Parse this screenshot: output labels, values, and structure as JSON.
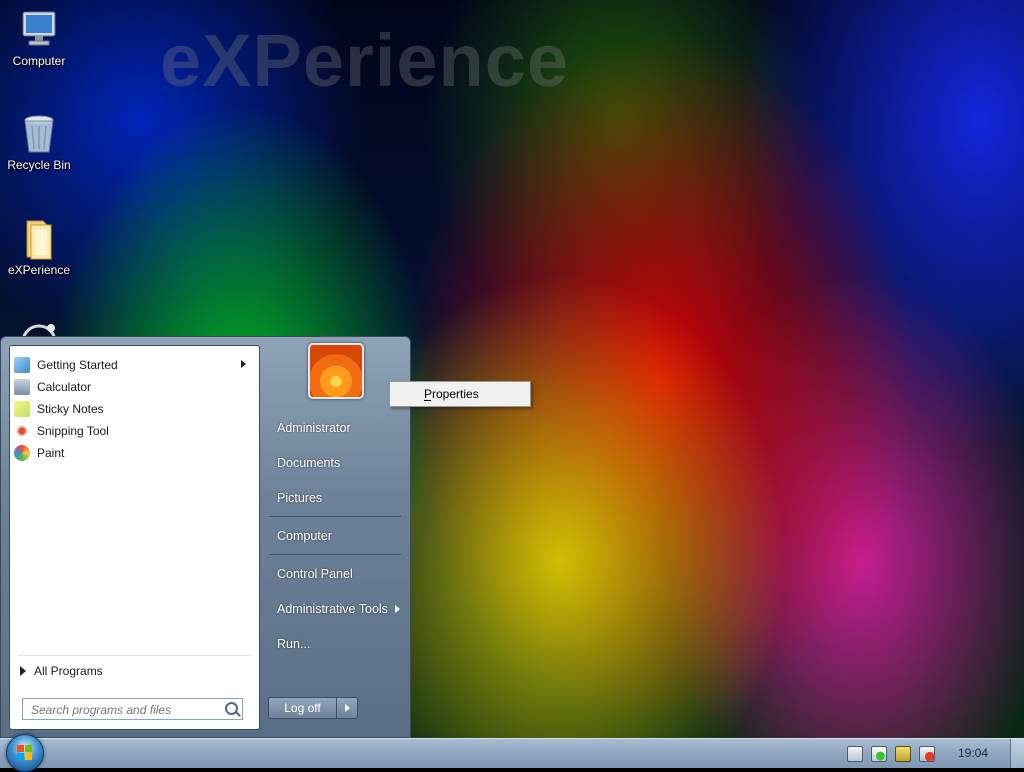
{
  "desktop": {
    "watermark": "eXPerience",
    "icons": [
      {
        "label": "Computer",
        "icon": "computer-icon"
      },
      {
        "label": "Recycle Bin",
        "icon": "recycle-bin-icon"
      },
      {
        "label": "eXPerience",
        "icon": "folder-icon"
      },
      {
        "label": "",
        "icon": "partial-icon"
      }
    ]
  },
  "start_menu": {
    "programs": [
      {
        "label": "Getting Started",
        "icon": "getting-started-icon",
        "has_submenu": true
      },
      {
        "label": "Calculator",
        "icon": "calculator-icon"
      },
      {
        "label": "Sticky Notes",
        "icon": "sticky-notes-icon"
      },
      {
        "label": "Snipping Tool",
        "icon": "snipping-tool-icon"
      },
      {
        "label": "Paint",
        "icon": "paint-icon"
      }
    ],
    "all_programs": "All Programs",
    "search": {
      "placeholder": "Search programs and files",
      "value": ""
    },
    "right_items": [
      {
        "label": "Administrator"
      },
      {
        "label": "Documents"
      },
      {
        "label": "Pictures"
      },
      {
        "label": "Computer"
      },
      {
        "label": "Control Panel"
      },
      {
        "label": "Administrative Tools",
        "has_submenu": true
      },
      {
        "label": "Run..."
      }
    ],
    "log_off": "Log off"
  },
  "context_menu": {
    "items": [
      {
        "label": "Properties",
        "accelerator": "P"
      }
    ]
  },
  "taskbar": {
    "clock": "19:04",
    "tray_icons": [
      "action-center-icon",
      "security-shield-icon",
      "network-icon",
      "volume-muted-icon"
    ]
  },
  "colors": {
    "start_menu_frame": "#6d8298",
    "taskbar": "#8ea6bf",
    "orb": "#3c8fd0"
  }
}
